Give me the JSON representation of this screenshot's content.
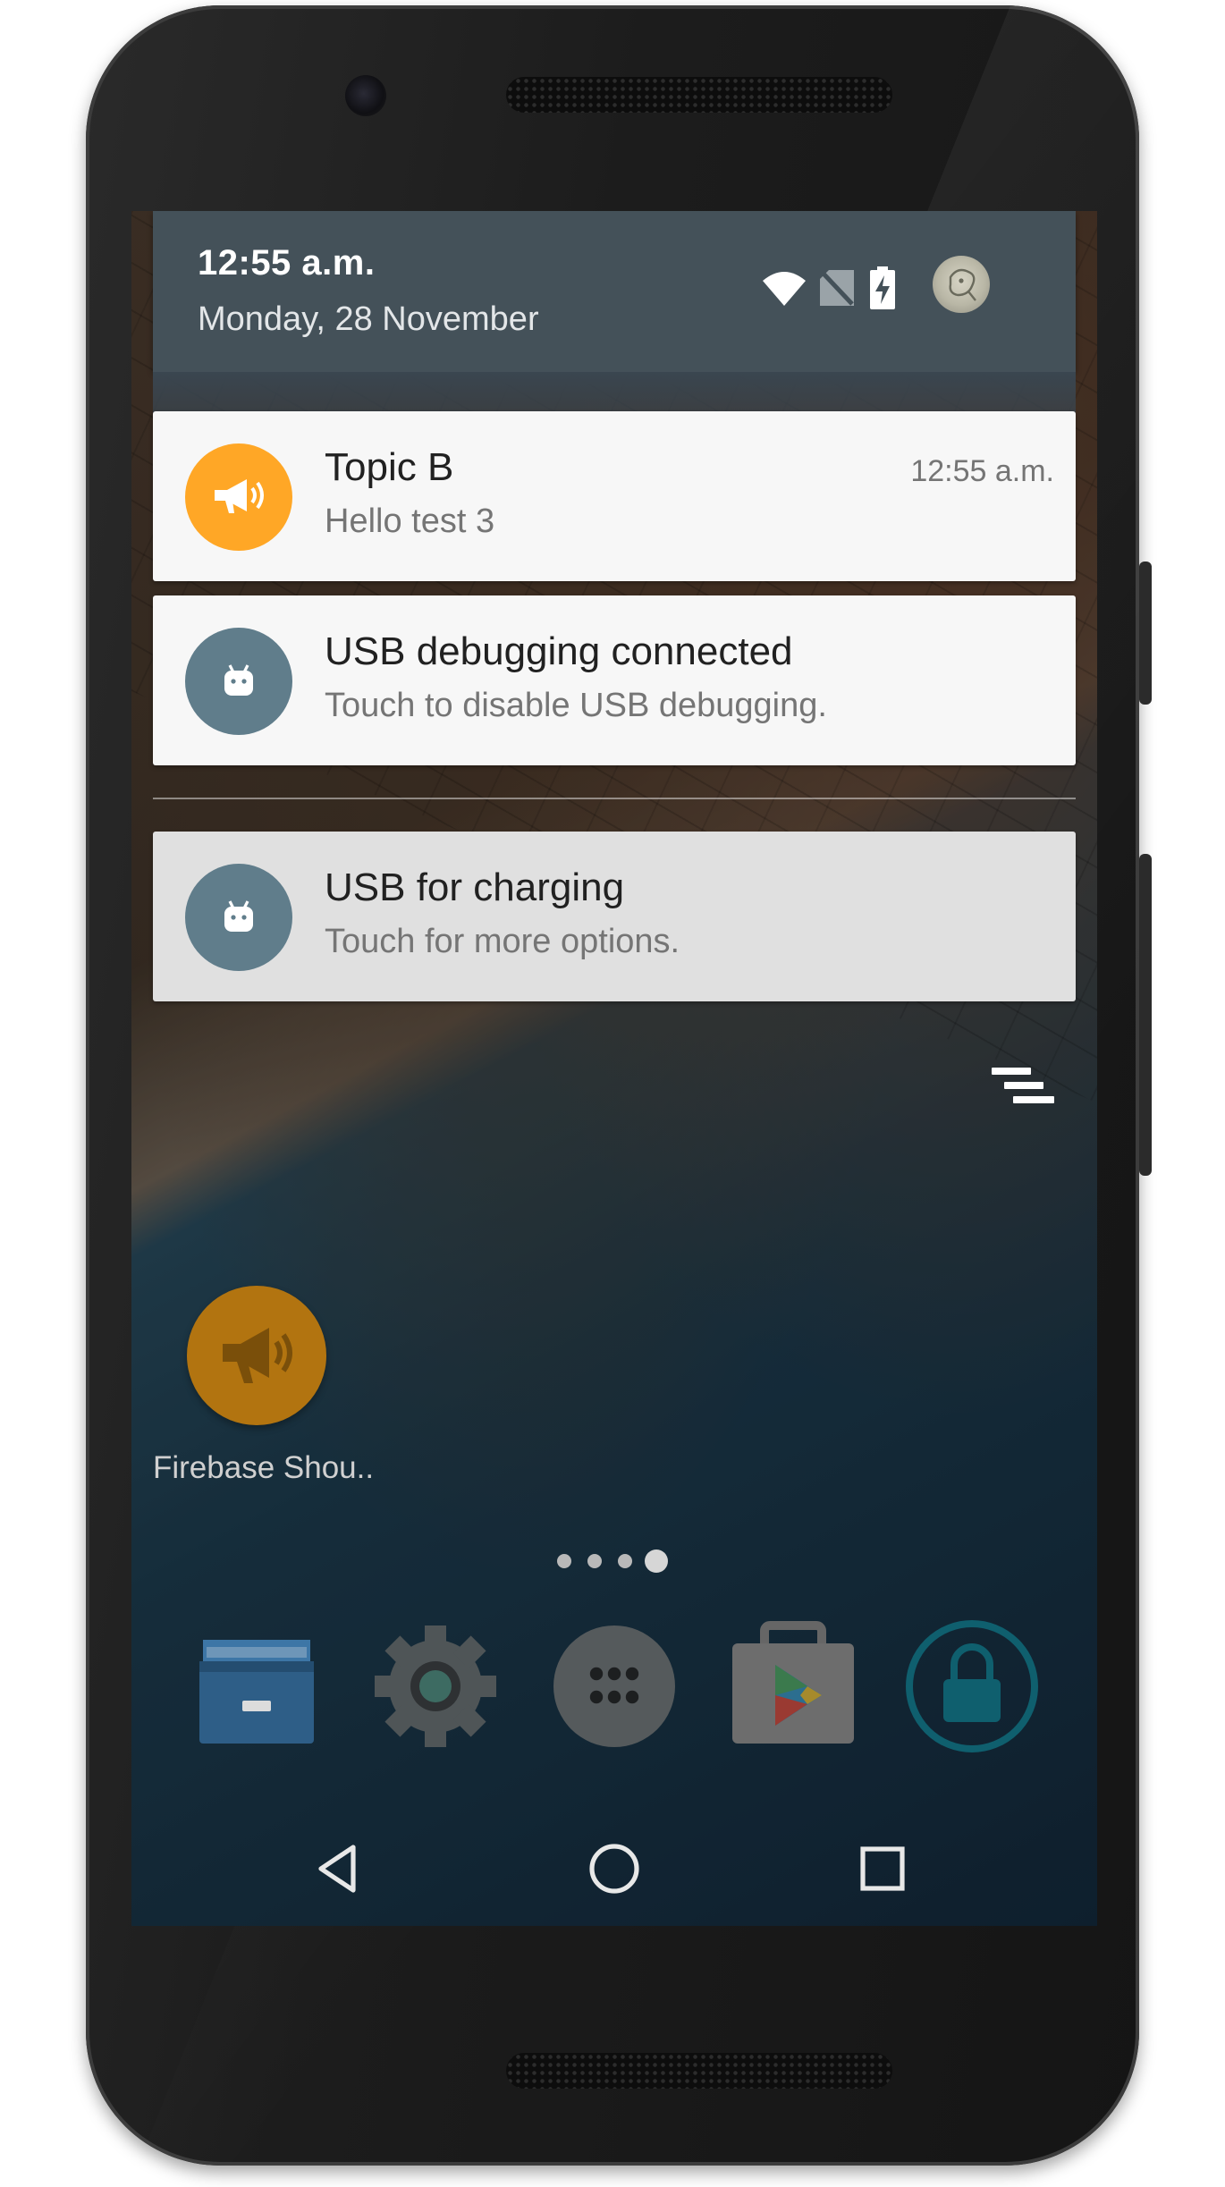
{
  "status_bar": {
    "time": "12:55 a.m.",
    "date": "Monday, 28 November",
    "icons": [
      "wifi-icon",
      "no-sim-icon",
      "battery-charging-icon",
      "avatar"
    ]
  },
  "notifications": [
    {
      "app_icon": "megaphone-icon",
      "title": "Topic B",
      "text": "Hello test 3",
      "time": "12:55 a.m.",
      "color": "#FFA726"
    },
    {
      "app_icon": "android-icon",
      "title": "USB debugging connected",
      "text": "Touch to disable USB debugging.",
      "color": "#607D8B"
    },
    {
      "app_icon": "android-icon",
      "title": "USB for charging",
      "text": "Touch for more options.",
      "color": "#607D8B"
    }
  ],
  "clear_all": {
    "icon": "clear-all-icon"
  },
  "home": {
    "shortcut": {
      "icon": "megaphone-icon",
      "label": "Firebase Shou.."
    },
    "page_indicator": {
      "pages": 4,
      "current": 4
    },
    "dock": [
      "file-manager-icon",
      "settings-icon",
      "app-drawer-icon",
      "play-store-icon",
      "lock-icon"
    ]
  },
  "navigation": [
    "back-icon",
    "home-icon",
    "recents-icon"
  ],
  "colors": {
    "header": "#445159",
    "notification_bg": "#F7F7F7",
    "accent_orange": "#FFA726",
    "slate": "#607D8B"
  }
}
